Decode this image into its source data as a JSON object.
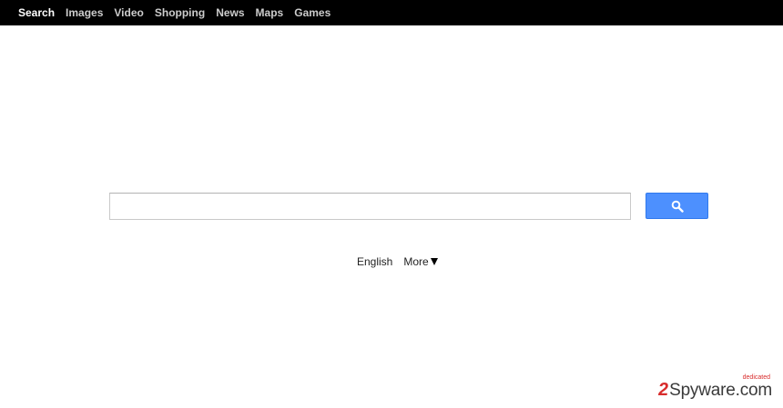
{
  "nav": {
    "items": [
      {
        "label": "Search",
        "active": true
      },
      {
        "label": "Images",
        "active": false
      },
      {
        "label": "Video",
        "active": false
      },
      {
        "label": "Shopping",
        "active": false
      },
      {
        "label": "News",
        "active": false
      },
      {
        "label": "Maps",
        "active": false
      },
      {
        "label": "Games",
        "active": false
      }
    ]
  },
  "search": {
    "value": "",
    "placeholder": "",
    "button_icon": "magnifier-icon",
    "button_color": "#4d90fe"
  },
  "footer": {
    "language": "English",
    "more_label": "More"
  },
  "watermark": {
    "brand_number": "2",
    "brand_text": "Spyware.com",
    "tagline": "dedicated"
  },
  "colors": {
    "topbar": "#000000",
    "active_nav": "#ffffff",
    "inactive_nav": "#cccccc",
    "brand_red": "#d82c2c"
  }
}
